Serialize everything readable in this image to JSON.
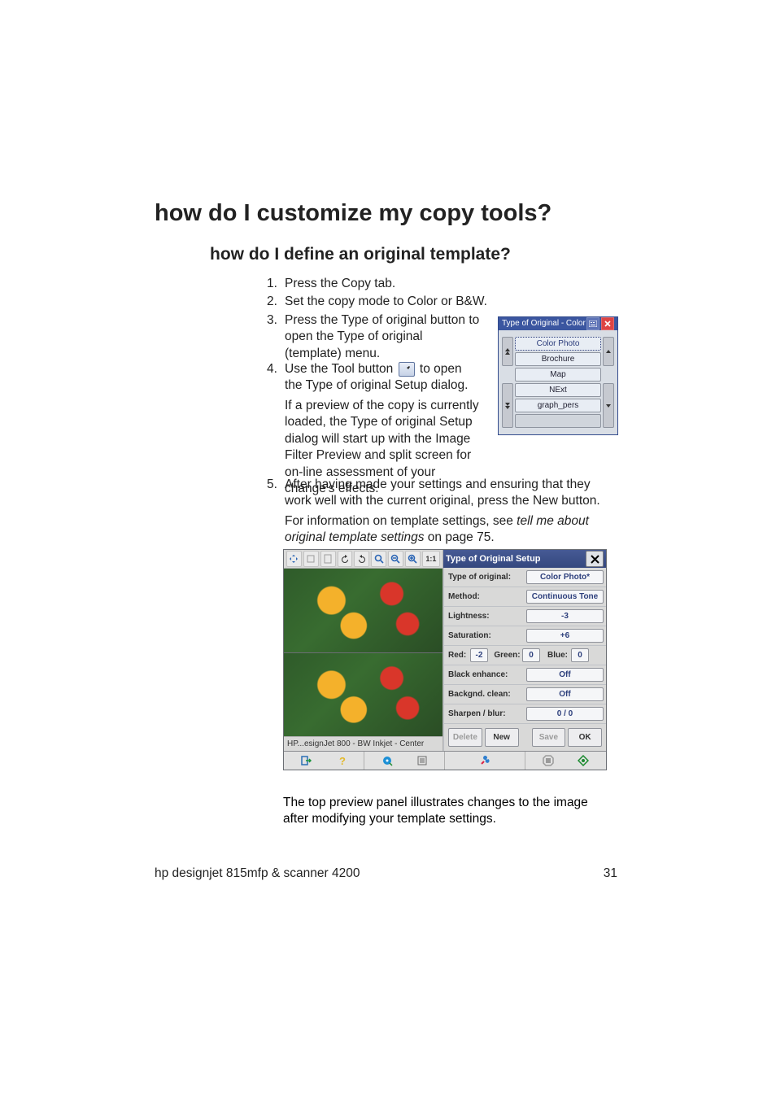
{
  "headings": {
    "h1": "how do I customize my copy tools?",
    "h2": "how do I define an original template?"
  },
  "steps": {
    "s1": {
      "n": "1.",
      "t": "Press the Copy tab."
    },
    "s2": {
      "n": "2.",
      "t": "Set the copy mode to Color or B&W."
    },
    "s3": {
      "n": "3.",
      "t": "Press the Type of original button to open the Type of original (template) menu."
    },
    "s4": {
      "n": "4.",
      "t1": "Use the Tool button ",
      "t2": " to open the Type of original Setup dialog."
    },
    "s4p": "If a preview of the copy is currently loaded, the Type of original Setup dialog will start up with the Image Filter Preview and split screen for on-line assessment of your change's effects.",
    "s5": {
      "n": "5.",
      "t": "After having made your settings and ensuring that they work well with the current original, press the New button."
    },
    "s5p_pre": "For information on template settings, see ",
    "s5p_em": "tell me about original template settings",
    "s5p_post": " on page 75."
  },
  "dlg1": {
    "title": "Type of Original - Color",
    "items": [
      "Color Photo",
      "Brochure",
      "Map",
      "NExt",
      "graph_pers"
    ]
  },
  "shot": {
    "toolbar_11": "1:1",
    "panel_title": "Type of Original Setup",
    "rows": {
      "type_of_original": {
        "lbl": "Type of original:",
        "val": "Color Photo*"
      },
      "method": {
        "lbl": "Method:",
        "val": "Continuous Tone"
      },
      "lightness": {
        "lbl": "Lightness:",
        "val": "-3"
      },
      "saturation": {
        "lbl": "Saturation:",
        "val": "+6"
      },
      "rgb": {
        "red_lbl": "Red:",
        "red": "-2",
        "green_lbl": "Green:",
        "green": "0",
        "blue_lbl": "Blue:",
        "blue": "0"
      },
      "black_enhance": {
        "lbl": "Black enhance:",
        "val": "Off"
      },
      "bgclean": {
        "lbl": "Backgnd. clean:",
        "val": "Off"
      },
      "sharpen": {
        "lbl": "Sharpen / blur:",
        "val": "0 / 0"
      }
    },
    "buttons": {
      "delete": "Delete",
      "new": "New",
      "save": "Save",
      "ok": "OK"
    },
    "profile": "HP...esignJet 800 - BW Inkjet - Center"
  },
  "caption": "The top preview panel illustrates changes to the image after modifying your template settings.",
  "footer": {
    "product": "hp designjet 815mfp & scanner 4200",
    "page": "31"
  }
}
